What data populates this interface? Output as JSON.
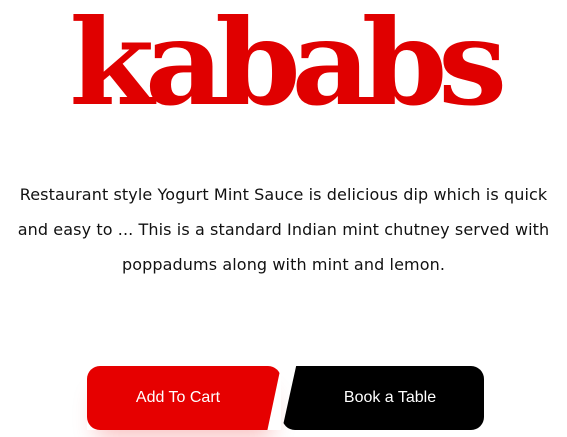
{
  "hero": {
    "title": "kababs"
  },
  "description": {
    "text": "Restaurant style Yogurt Mint Sauce is delicious dip which is quick and easy to ... This is a standard Indian mint chutney served with poppadums along with mint and lemon."
  },
  "actions": {
    "add_to_cart_label": "Add To Cart",
    "book_table_label": "Book a Table"
  },
  "colors": {
    "accent": "#e60000",
    "title": "#e00000",
    "dark": "#000000",
    "text": "#111111"
  }
}
